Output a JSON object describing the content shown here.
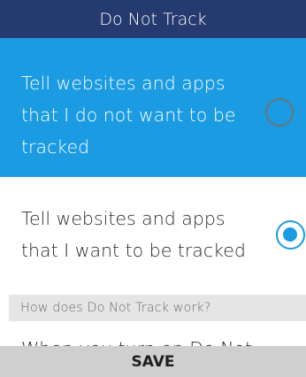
{
  "header": {
    "title": "Do Not Track"
  },
  "options": [
    {
      "label": "Tell websites and apps that I do not want to be tracked",
      "selected": false,
      "focused": true
    },
    {
      "label": "Tell websites and apps that I want to be tracked",
      "selected": true,
      "focused": false
    }
  ],
  "info": {
    "question": "How does Do Not Track work?"
  },
  "body_text": {
    "partial": "When you turn on Do Not"
  },
  "footer": {
    "save_label": "SAVE"
  },
  "colors": {
    "header_bg": "#253a6e",
    "accent": "#1a9be2",
    "info_bg": "#e5e5e5",
    "footer_bg": "#cfcfcf"
  }
}
